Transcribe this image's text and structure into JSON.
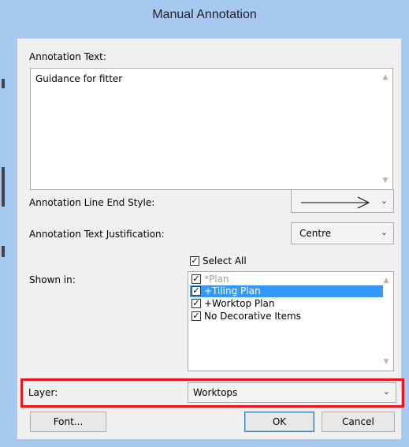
{
  "dialog": {
    "title": "Manual Annotation",
    "annotation_text_label": "Annotation Text:",
    "annotation_text_value": "Guidance for fitter",
    "line_end_style_label": "Annotation Line End Style:",
    "line_end_style_icon": "arrow-right-line-icon",
    "text_justification_label": "Annotation Text Justification:",
    "text_justification_value": "Centre",
    "select_all_label": "Select All",
    "shown_in_label": "Shown in:",
    "shown_in_items": [
      {
        "label": "*Plan",
        "checked": true,
        "disabled": true
      },
      {
        "label": "+Tiling Plan",
        "checked": true,
        "selected": true
      },
      {
        "label": "+Worktop Plan",
        "checked": true
      },
      {
        "label": "No Decorative Items",
        "checked": true
      }
    ],
    "layer_label": "Layer:",
    "layer_value": "Worktops",
    "font_button": "Font...",
    "ok_button": "OK",
    "cancel_button": "Cancel",
    "colors": {
      "highlight": "#e8141e",
      "selection": "#3399ff",
      "titlebar": "#a7c8f0"
    }
  }
}
